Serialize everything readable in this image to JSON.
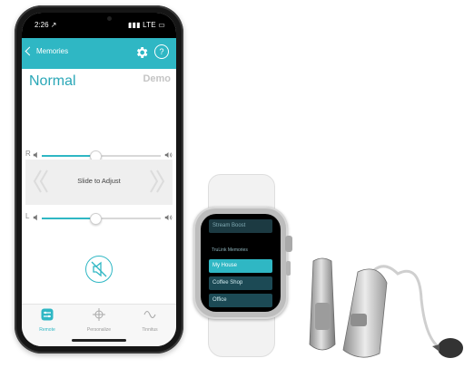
{
  "phone": {
    "status": {
      "time": "2:26 ↗",
      "signal": "LTE"
    },
    "nav": {
      "back_label": "Memories"
    },
    "memory_title": "Normal",
    "demo_label": "Demo",
    "right_slider": {
      "channel": "R",
      "value_pct": 45
    },
    "left_slider": {
      "channel": "L",
      "value_pct": 45
    },
    "adjust_label": "Slide to Adjust",
    "tabs": [
      {
        "label": "Remote",
        "icon": "remote-icon",
        "active": true
      },
      {
        "label": "Personalize",
        "icon": "crosshair-icon",
        "active": false
      },
      {
        "label": "Tinnitus",
        "icon": "wave-icon",
        "active": false
      }
    ]
  },
  "watch": {
    "top_item": "Stream Boost",
    "header": "TruLink Memories",
    "items": [
      {
        "label": "My House",
        "selected": true
      },
      {
        "label": "Coffee Shop",
        "selected": false
      },
      {
        "label": "Office",
        "selected": false
      }
    ]
  },
  "colors": {
    "accent": "#2fb7c4"
  }
}
